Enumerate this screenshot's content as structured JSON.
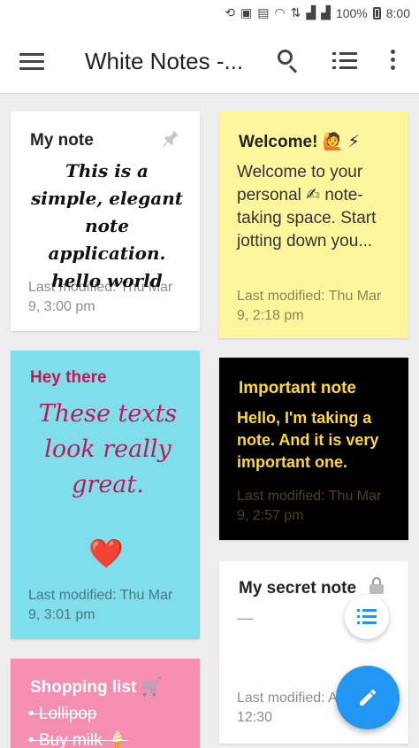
{
  "status_bar": {
    "icons": [
      "sync-icon",
      "notification-icon",
      "gallery-icon",
      "wifi-icon",
      "data-icon",
      "signal-icon",
      "signal-icon",
      "battery-icon"
    ],
    "battery": "100%",
    "time": "8:00"
  },
  "app_bar": {
    "title": "White Notes -...",
    "icons": [
      "menu-icon",
      "search-icon",
      "list-view-icon",
      "more-options-icon"
    ]
  },
  "notes": [
    {
      "title": "My note",
      "body": "This is a simple, elegant note application. hello world",
      "modified": "Last modified: Thu Mar 9, 3:00 pm",
      "background": "#ffffff",
      "title_color": "#222222",
      "body_color": "#111111",
      "pinned": true
    },
    {
      "title": "Welcome! 🙋 ⚡",
      "body": "Welcome to your personal ✍ note-taking space. Start jotting down you...",
      "modified": "Last modified: Thu Mar 9, 2:18 pm",
      "background": "#fff59d",
      "title_color": "#222222",
      "body_color": "#333333"
    },
    {
      "title": "Hey there",
      "body": "These texts look really great.",
      "emoji": "❤️",
      "modified": "Last modified: Thu Mar 9, 3:01 pm",
      "background": "#80deea",
      "title_color": "#c2185b",
      "body_color": "#c2185b"
    },
    {
      "title": "Important note",
      "body": "Hello, I'm taking a note. And it is very important one.",
      "modified": "Last modified: Thu Mar 9, 2:57 pm",
      "background": "#000000",
      "title_color": "#fdd835",
      "body_color": "#fdd835"
    },
    {
      "title": "My secret note",
      "body": "—",
      "modified": "Last modified: Aug 14, 12:30",
      "background": "#ffffff",
      "title_color": "#222222",
      "body_color": "#999999",
      "locked": true
    },
    {
      "title": "Shopping list 🛒",
      "items": [
        "• Lollipop",
        "• Buy milk 🍦"
      ],
      "background": "#f48fb1",
      "title_color": "#ffffff",
      "body_color": "#ffffff"
    }
  ],
  "fab": {
    "icon": "edit-pencil-icon",
    "color": "#2196f3"
  },
  "mini_fab": {
    "icon": "list-view-icon",
    "color": "#2196f3"
  }
}
